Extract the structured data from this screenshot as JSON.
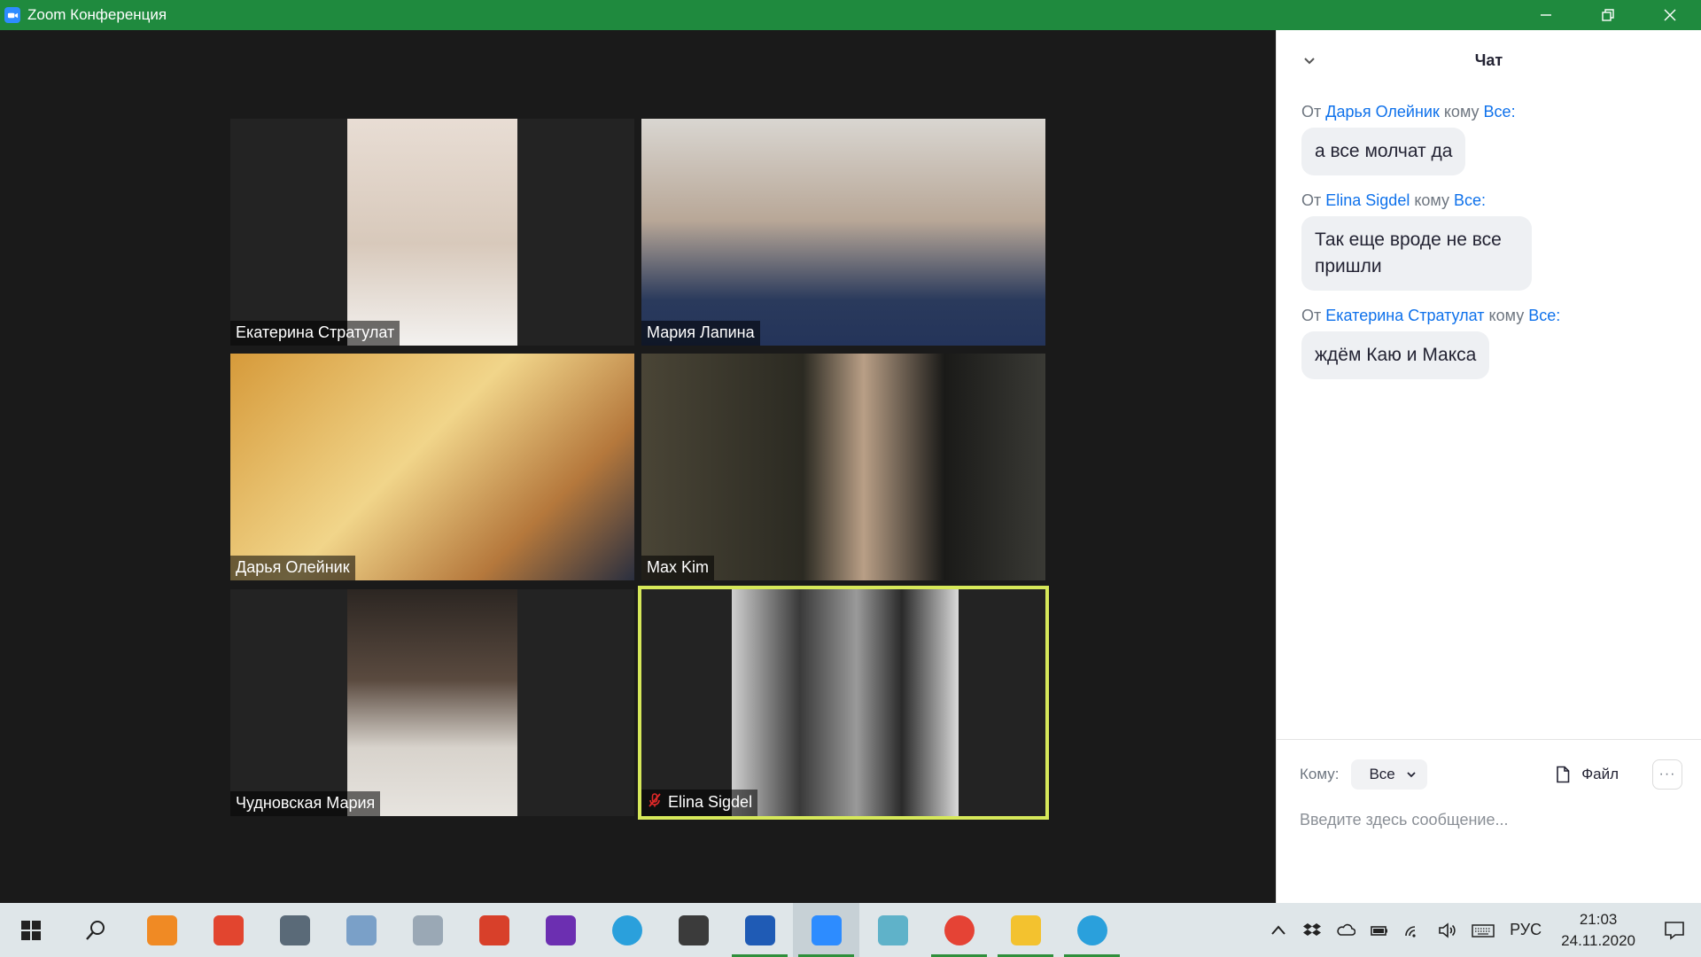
{
  "window": {
    "title": "Zoom Конференция"
  },
  "participants": [
    {
      "name": "Екатерина Стратулат",
      "muted": false,
      "active": false
    },
    {
      "name": "Мария Лапина",
      "muted": false,
      "active": false
    },
    {
      "name": "Дарья Олейник",
      "muted": false,
      "active": false
    },
    {
      "name": "Max Kim",
      "muted": false,
      "active": false
    },
    {
      "name": "Чудновская Мария",
      "muted": false,
      "active": false
    },
    {
      "name": "Elina Sigdel",
      "muted": true,
      "active": true
    }
  ],
  "chat": {
    "title": "Чат",
    "messages": [
      {
        "from_prefix": "От",
        "sender": "Дарья Олейник",
        "to_prefix": "кому",
        "recipient": "Все:",
        "text": "а все молчат да"
      },
      {
        "from_prefix": "От",
        "sender": "Elina Sigdel",
        "to_prefix": "кому",
        "recipient": "Все:",
        "text": "Так еще вроде не все пришли"
      },
      {
        "from_prefix": "От",
        "sender": "Екатерина Стратулат",
        "to_prefix": "кому",
        "recipient": "Все:",
        "text": "ждём Каю и Макса"
      }
    ],
    "composer": {
      "to_label": "Кому:",
      "to_value": "Все",
      "file_label": "Файл",
      "more_label": "···",
      "placeholder": "Введите здесь сообщение..."
    }
  },
  "taskbar": {
    "apps": [
      {
        "icon": "maps-icon",
        "color": "#f08a24",
        "running": false
      },
      {
        "icon": "snipping-tool-icon",
        "color": "#e2452f",
        "running": false
      },
      {
        "icon": "calculator-icon",
        "color": "#5a6a78",
        "running": false
      },
      {
        "icon": "paint-icon",
        "color": "#7aa0c8",
        "running": false
      },
      {
        "icon": "translator-icon",
        "color": "#9aa8b5",
        "running": false
      },
      {
        "icon": "ccleaner-icon",
        "color": "#d8402a",
        "running": false
      },
      {
        "icon": "visual-studio-icon",
        "color": "#6c2fb1",
        "running": false
      },
      {
        "icon": "telegram-icon",
        "color": "#2aa0dc",
        "running": false
      },
      {
        "icon": "settings-icon",
        "color": "#3b3b3b",
        "running": false
      },
      {
        "icon": "word-icon",
        "color": "#1f5bb5",
        "running": true
      },
      {
        "icon": "zoom-icon",
        "color": "#2d8cff",
        "running": true
      },
      {
        "icon": "notes-icon",
        "color": "#5fb2c9",
        "running": false
      },
      {
        "icon": "chrome-icon",
        "color": "#e54335",
        "running": true
      },
      {
        "icon": "file-explorer-icon",
        "color": "#f3c22f",
        "running": true
      },
      {
        "icon": "telegram-icon",
        "color": "#2aa0dc",
        "running": true
      }
    ],
    "language": "РУС",
    "time": "21:03",
    "date": "24.11.2020"
  }
}
